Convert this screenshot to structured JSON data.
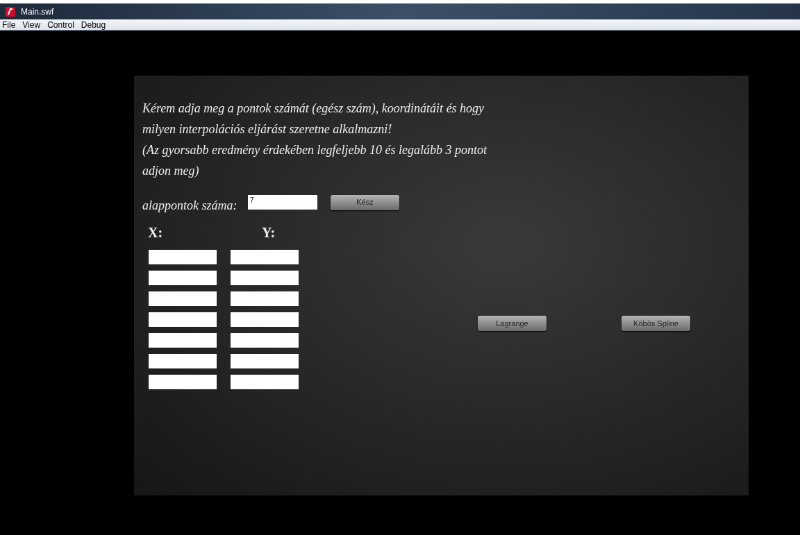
{
  "window": {
    "title": "Main.swf"
  },
  "menu": [
    "File",
    "View",
    "Control",
    "Debug"
  ],
  "prompt": [
    "Kérem adja meg a pontok számát (egész szám), koordinátáit és hogy",
    "milyen interpolációs eljárást szeretne alkalmazni!",
    "(Az gyorsabb eredmény érdekében legfeljebb 10 és legalább 3 pontot",
    "adjon meg)"
  ],
  "count": {
    "label": "alappontok száma:",
    "value": "7",
    "button": "Kész"
  },
  "columns": [
    "X:",
    "Y:"
  ],
  "rows": [
    {
      "kind": "pair"
    },
    {
      "kind": "pair"
    },
    {
      "kind": "pair"
    },
    {
      "kind": "pair"
    },
    {
      "kind": "pair"
    },
    {
      "kind": "pair"
    },
    {
      "kind": "pair"
    }
  ],
  "methods": [
    "Lagrange",
    "Köbös Spline"
  ]
}
